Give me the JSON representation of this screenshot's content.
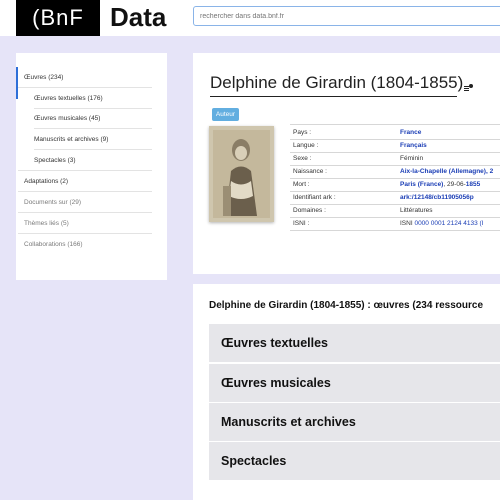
{
  "header": {
    "logo_left": "(BnF",
    "logo_right": "Data",
    "search_placeholder": "rechercher dans data.bnf.fr"
  },
  "sidebar": {
    "items": [
      {
        "label": "Œuvres (234)"
      },
      {
        "label": "Œuvres textuelles (176)"
      },
      {
        "label": "Œuvres musicales (45)"
      },
      {
        "label": "Manuscrits et archives (9)"
      },
      {
        "label": "Spectacles (3)"
      },
      {
        "label": "Adaptations (2)"
      },
      {
        "label": "Documents sur (29)"
      },
      {
        "label": "Thèmes liés (5)"
      },
      {
        "label": "Collaborations (166)"
      }
    ]
  },
  "author": {
    "name": "Delphine de Girardin (1804-1855)",
    "badge": "Auteur",
    "info": [
      {
        "label": "Pays :",
        "value": "France",
        "link": true
      },
      {
        "label": "Langue :",
        "value": "Français",
        "link": true
      },
      {
        "label": "Sexe :",
        "value": "Féminin",
        "link": false
      },
      {
        "label": "Naissance :",
        "value": "Aix-la-Chapelle (Allemagne), 2",
        "link": true
      },
      {
        "label": "Mort :",
        "value_link": "Paris (France)",
        "value_rest": ", 29-06-",
        "value_year": "1855"
      },
      {
        "label": "Identifiant ark :",
        "value": "ark:/12148/cb11905056p",
        "link": true
      },
      {
        "label": "Domaines :",
        "value": "Littératures",
        "link": false
      },
      {
        "label": "ISNI :",
        "value_prefix": "ISNI ",
        "value_link": "0000 0001 2124 4133 (I",
        "link": true
      }
    ]
  },
  "oeuvres": {
    "heading": "Delphine de Girardin (1804-1855) : œuvres (234 ressource",
    "sections": [
      {
        "label": "Œuvres textuelles"
      },
      {
        "label": "Œuvres musicales"
      },
      {
        "label": "Manuscrits et archives"
      },
      {
        "label": "Spectacles"
      }
    ]
  },
  "colors": {
    "background": "#e6e4f8",
    "link": "#1a3db5",
    "badge": "#62aee0",
    "active_indicator": "#2e6fd8"
  }
}
